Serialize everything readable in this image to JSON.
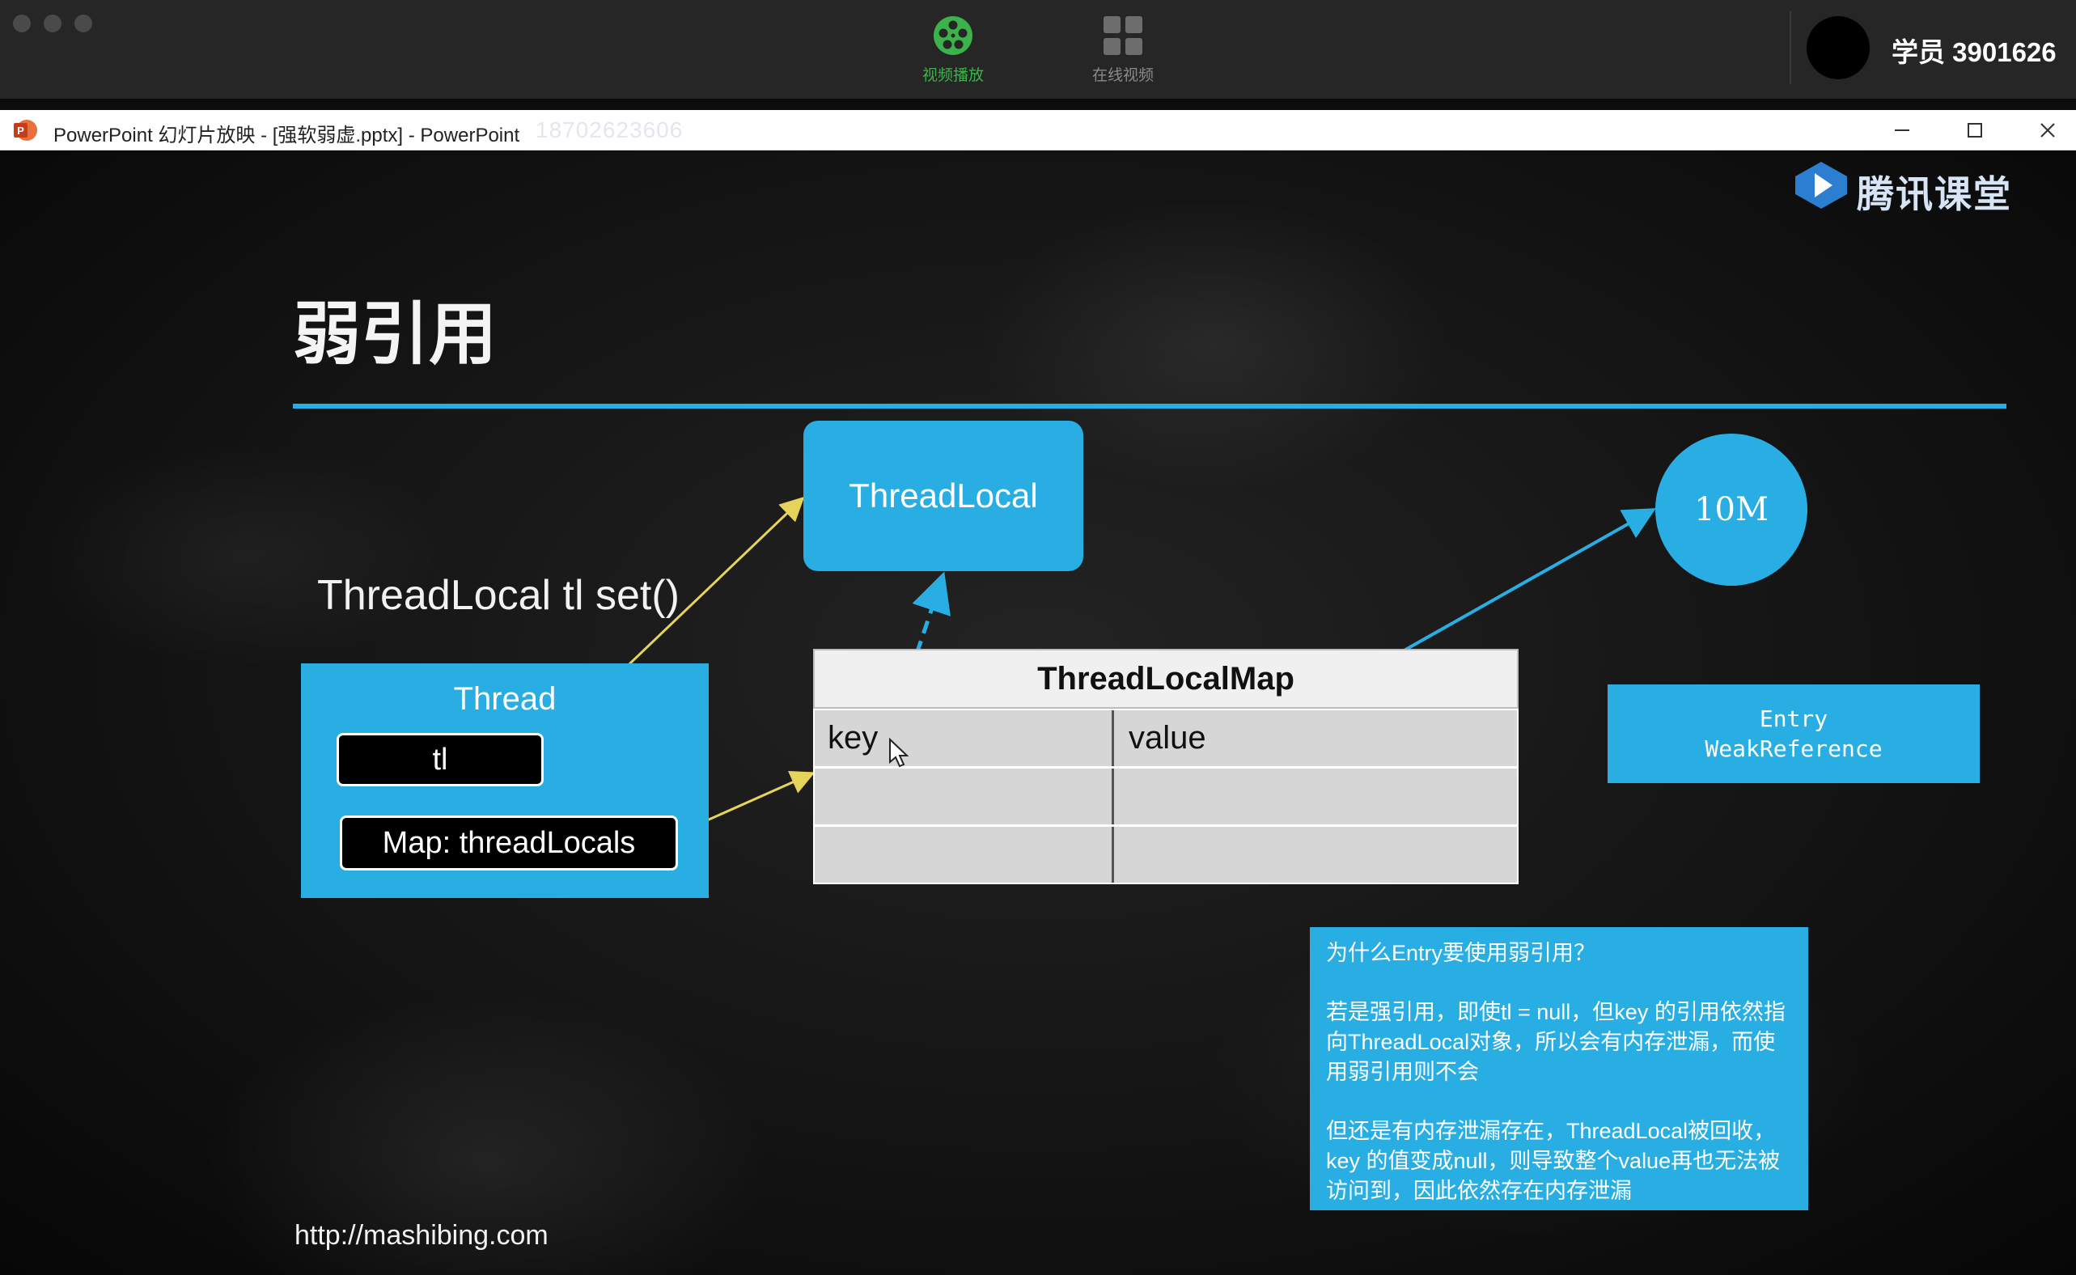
{
  "app": {
    "nav_tabs": [
      {
        "label": "视频播放",
        "icon": "film-reel-icon",
        "active": true
      },
      {
        "label": "在线视频",
        "icon": "grid-icon",
        "active": false
      }
    ],
    "user_name": "学员 3901626"
  },
  "window": {
    "title": "PowerPoint 幻灯片放映 - [强软弱虚.pptx] - PowerPoint",
    "watermark": "18702623606",
    "controls": [
      "minimize-icon",
      "maximize-icon",
      "close-icon"
    ]
  },
  "slide": {
    "brand": "腾讯课堂",
    "title": "弱引用",
    "threadlocal_label": "ThreadLocal",
    "call_text": "ThreadLocal tl set()",
    "thread_box": {
      "title": "Thread",
      "field_tl": "tl",
      "field_map": "Map: threadLocals"
    },
    "map_table": {
      "title": "ThreadLocalMap",
      "rows": [
        {
          "key": "key",
          "value": "value"
        },
        {
          "key": "",
          "value": ""
        },
        {
          "key": "",
          "value": ""
        }
      ]
    },
    "value_circle": "10M",
    "entry_box": {
      "line1": "Entry",
      "line2": "WeakReference"
    },
    "note": {
      "question": "为什么Entry要使用弱引用？",
      "para1": "若是强引用，即使tl = null，但key 的引用依然指向ThreadLocal对象，所以会有内存泄漏，而使用弱引用则不会",
      "para2": "但还是有内存泄漏存在，ThreadLocal被回收，key 的值变成null，则导致整个value再也无法被访问到，因此依然存在内存泄漏"
    },
    "url": "http://mashibing.com"
  },
  "colors": {
    "accent_blue": "#29aee3",
    "arrow_yellow": "#e5d35a",
    "active_green": "#3bb34a",
    "chalk_bg": "#141414"
  }
}
